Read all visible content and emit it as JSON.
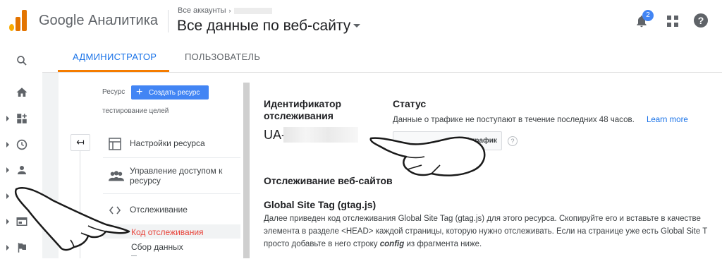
{
  "header": {
    "app_name": "Google Аналитика",
    "breadcrumb": "Все аккаунты",
    "breadcrumb_chevron": "›",
    "view_title": "Все данные по веб-сайту",
    "notifications_count": "2",
    "help_glyph": "?"
  },
  "colors": {
    "accent_blue": "#1a73e8",
    "tab_underline": "#f57c00",
    "active_menu_text": "#e8453c",
    "button_blue": "#4285f4"
  },
  "rail": {
    "icons": [
      "search-icon",
      "home-icon",
      "customization-icon",
      "realtime-clock-icon",
      "audience-person-icon",
      "acquisition-icon",
      "behavior-icon",
      "conversions-flag-icon"
    ]
  },
  "tabs": {
    "admin": "АДМИНИСТРАТОР",
    "user": "ПОЛЬЗОВАТЕЛЬ"
  },
  "property": {
    "label": "Ресурс",
    "create_button": "Создать ресурс",
    "create_plus": "+",
    "name": "тестирование целей",
    "back_glyph": "↤",
    "menu": [
      {
        "icon": "property-settings-icon",
        "label": "Настройки ресурса"
      },
      {
        "icon": "user-management-icon",
        "label": "Управление доступом к ресурсу"
      },
      {
        "icon": "code-brackets-icon",
        "label": "Отслеживание"
      }
    ],
    "submenu": [
      {
        "label": "Код отслеживания",
        "active": true
      },
      {
        "label": "Сбор данных",
        "active": false
      }
    ]
  },
  "tracking": {
    "id_label": "Идентификатор отслеживания",
    "id_value": "UA-",
    "status_label": "Статус",
    "status_text": "Данные о трафике не поступают в течение последних 48 часов.",
    "learn_more": "Learn more",
    "send_button": "ый трафик",
    "help_glyph": "?",
    "site_tracking_heading": "Отслеживание веб-сайтов",
    "gtag_heading": "Global Site Tag (gtag.js)",
    "desc_line1": "Далее приведен код отслеживания Global Site Tag (gtag.js) для этого ресурса. Скопируйте его и вставьте в качестве",
    "desc_line2": "элемента в разделе <HEAD> каждой страницы, которую нужно отслеживать. Если на странице уже есть Global Site T",
    "desc_line3_pre": "просто добавьте в него строку ",
    "desc_line3_bold": "config",
    "desc_line3_post": " из фрагмента ниже."
  }
}
